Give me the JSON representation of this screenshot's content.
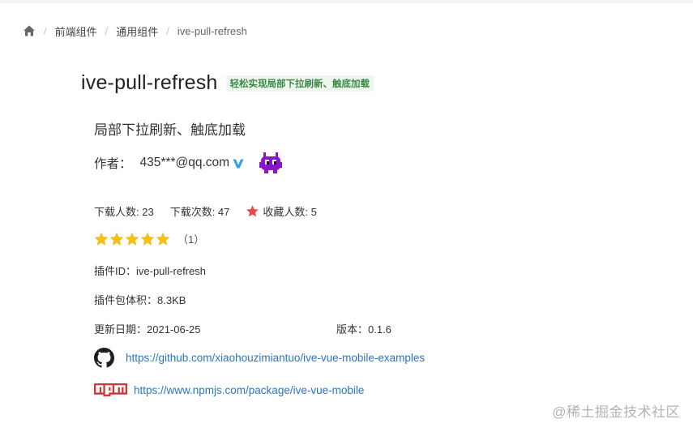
{
  "breadcrumb": {
    "items": [
      "前端组件",
      "通用组件"
    ],
    "current": "ive-pull-refresh",
    "separator": "/"
  },
  "plugin": {
    "title": "ive-pull-refresh",
    "tag": "轻松实现局部下拉刷新、触底加载",
    "description": "局部下拉刷新、触底加载",
    "author_label": "作者：",
    "author": "435***@qq.com",
    "stats": {
      "download_users": "下载人数: 23",
      "download_count": "下载次数: 47",
      "favorites": "收藏人数: 5"
    },
    "rating": {
      "stars": 5,
      "max": 5,
      "count_text": "（1）"
    },
    "id_line": "插件ID：ive-pull-refresh",
    "size_line": "插件包体积：8.3KB",
    "updated_line": "更新日期：2021-06-25",
    "version_line": "版本：0.1.6",
    "github_url": "https://github.com/xiaohouzimiantuo/ive-vue-mobile-examples",
    "npm_url": "https://www.npmjs.com/package/ive-vue-mobile"
  },
  "watermark": "@稀土掘金技术社区",
  "icons": {
    "home": "home-icon",
    "verify": "verified-v-icon",
    "avatar": "purple-invader-avatar",
    "favorite": "red-star-icon",
    "rating": "yellow-star-icon",
    "github": "github-icon",
    "npm": "npm-logo"
  },
  "colors": {
    "link": "#2a74c9",
    "tag_bg": "#eef7ee",
    "tag_text": "#3c8a45",
    "rating_star": "#f7c20f",
    "favorite_star": "#e8474b",
    "avatar": "#8a16c9",
    "npm": "#cb3837"
  }
}
